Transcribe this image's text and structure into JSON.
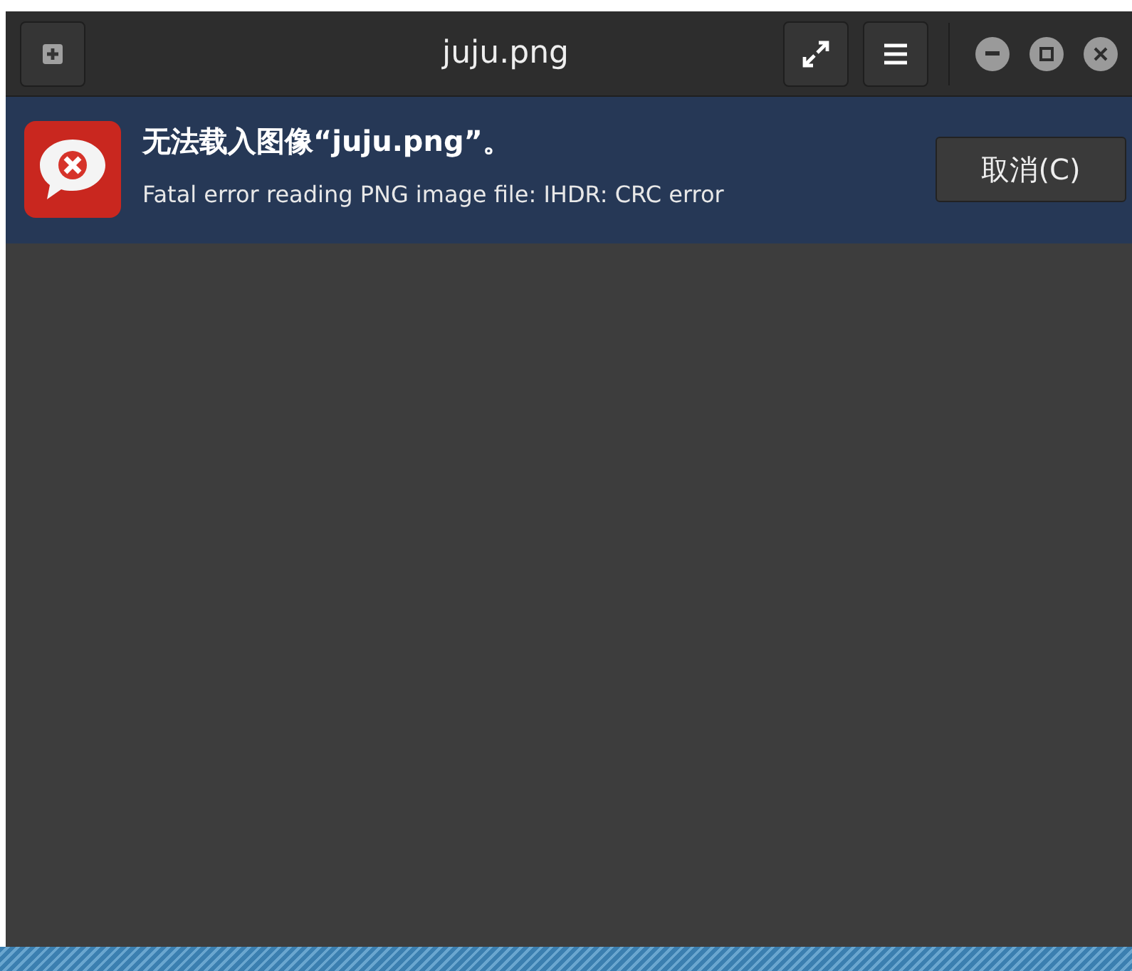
{
  "window": {
    "title": "juju.png"
  },
  "error_bar": {
    "title": "无法载入图像“juju.png”。",
    "message": "Fatal error reading PNG image file: IHDR: CRC error",
    "button": "取消(C)"
  }
}
